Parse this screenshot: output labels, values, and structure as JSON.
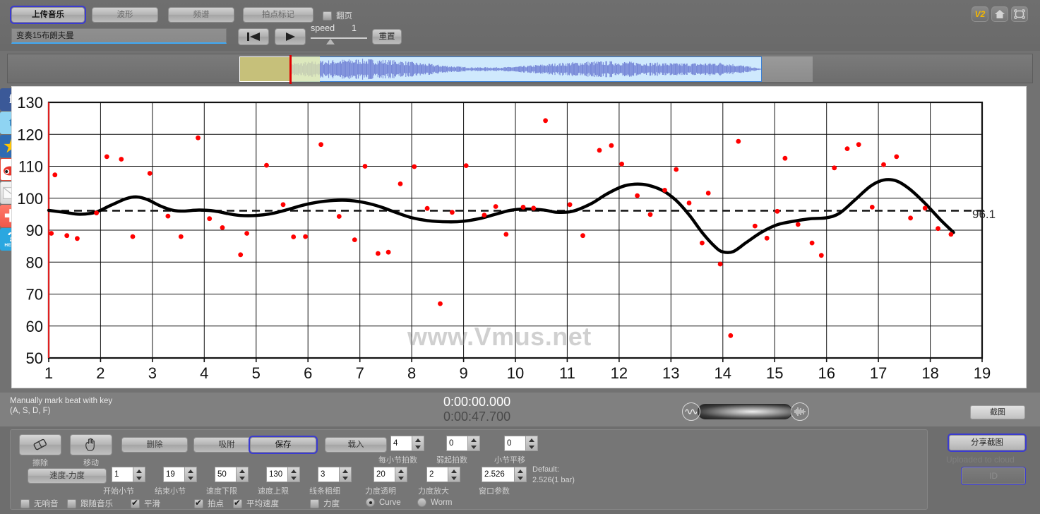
{
  "toolbar": {
    "buttons": [
      {
        "id": "upload",
        "label": "上传音乐",
        "selected": true
      },
      {
        "id": "wave",
        "label": "波形",
        "selected": false
      },
      {
        "id": "spectrum",
        "label": "频谱",
        "selected": false
      },
      {
        "id": "beatmark",
        "label": "拍点标记",
        "selected": false
      }
    ],
    "page_flip_label": "翻页",
    "page_flip_checked": false,
    "file_name": "变奏15布朗夫曼",
    "speed_label": "speed",
    "speed_value": "1",
    "reset_label": "重置",
    "corner_icons": [
      {
        "name": "v2-badge-icon",
        "label": "V2"
      },
      {
        "name": "home-icon",
        "label": ""
      },
      {
        "name": "fullscreen-icon",
        "label": ""
      }
    ]
  },
  "social": [
    {
      "name": "facebook-icon",
      "glyph": "f"
    },
    {
      "name": "twitter-icon",
      "glyph": "t"
    },
    {
      "name": "qzone-star-icon",
      "glyph": "★"
    },
    {
      "name": "weibo-icon",
      "glyph": "🅦"
    },
    {
      "name": "email-icon",
      "glyph": "✉"
    },
    {
      "name": "share-plus-icon",
      "glyph": "✚"
    },
    {
      "name": "help-icon",
      "glyph": "?",
      "sub": "HELP"
    }
  ],
  "chart_data": {
    "type": "scatter",
    "title": "",
    "xlabel": "",
    "ylabel": "",
    "watermark": "www.Vmus.net",
    "xlim": [
      1,
      19
    ],
    "ylim": [
      50,
      130
    ],
    "xticks": [
      1,
      2,
      3,
      4,
      5,
      6,
      7,
      8,
      9,
      10,
      11,
      12,
      13,
      14,
      15,
      16,
      17,
      18,
      19
    ],
    "yticks": [
      50,
      60,
      70,
      80,
      90,
      100,
      110,
      120,
      130
    ],
    "grid": true,
    "mean_line": {
      "value": 96.1,
      "label": "96.1",
      "style": "dashed"
    },
    "series": [
      {
        "name": "beat tempo points",
        "type": "scatter",
        "color": "#ff0000",
        "points": [
          [
            1.05,
            89.0
          ],
          [
            1.12,
            107.3
          ],
          [
            1.35,
            88.3
          ],
          [
            1.55,
            87.4
          ],
          [
            1.92,
            95.4
          ],
          [
            2.12,
            113.0
          ],
          [
            2.4,
            112.2
          ],
          [
            2.62,
            88.0
          ],
          [
            2.95,
            107.8
          ],
          [
            3.3,
            94.4
          ],
          [
            3.55,
            88.0
          ],
          [
            3.88,
            118.9
          ],
          [
            4.1,
            93.6
          ],
          [
            4.35,
            90.8
          ],
          [
            4.7,
            82.3
          ],
          [
            4.82,
            89.0
          ],
          [
            5.2,
            110.3
          ],
          [
            5.52,
            98.0
          ],
          [
            5.72,
            87.9
          ],
          [
            5.95,
            88.0
          ],
          [
            6.25,
            116.8
          ],
          [
            6.6,
            94.3
          ],
          [
            6.9,
            87.0
          ],
          [
            7.1,
            110.0
          ],
          [
            7.35,
            82.7
          ],
          [
            7.55,
            83.1
          ],
          [
            7.78,
            104.5
          ],
          [
            8.05,
            109.9
          ],
          [
            8.3,
            96.8
          ],
          [
            8.55,
            67.0
          ],
          [
            8.78,
            95.6
          ],
          [
            9.05,
            110.2
          ],
          [
            9.4,
            94.7
          ],
          [
            9.62,
            97.4
          ],
          [
            9.82,
            88.7
          ],
          [
            10.15,
            97.2
          ],
          [
            10.35,
            96.9
          ],
          [
            10.58,
            124.3
          ],
          [
            11.05,
            98.0
          ],
          [
            11.3,
            88.3
          ],
          [
            11.62,
            115.0
          ],
          [
            11.85,
            116.5
          ],
          [
            12.05,
            110.7
          ],
          [
            12.35,
            100.8
          ],
          [
            12.6,
            94.9
          ],
          [
            12.88,
            102.5
          ],
          [
            13.1,
            109.0
          ],
          [
            13.35,
            98.5
          ],
          [
            13.6,
            86.0
          ],
          [
            13.72,
            101.6
          ],
          [
            13.95,
            79.4
          ],
          [
            14.15,
            57.0
          ],
          [
            14.3,
            117.8
          ],
          [
            14.62,
            91.3
          ],
          [
            14.85,
            87.5
          ],
          [
            15.05,
            95.9
          ],
          [
            15.2,
            112.5
          ],
          [
            15.45,
            91.8
          ],
          [
            15.72,
            86.0
          ],
          [
            15.9,
            82.1
          ],
          [
            16.15,
            109.5
          ],
          [
            16.4,
            115.5
          ],
          [
            16.62,
            116.8
          ],
          [
            16.88,
            97.2
          ],
          [
            17.1,
            110.5
          ],
          [
            17.35,
            113.0
          ],
          [
            17.62,
            93.8
          ],
          [
            17.9,
            96.9
          ],
          [
            18.15,
            90.5
          ],
          [
            18.4,
            88.7
          ]
        ]
      },
      {
        "name": "smoothed tempo curve",
        "type": "line",
        "color": "#000000",
        "points": [
          [
            1.0,
            96.2
          ],
          [
            1.3,
            95.6
          ],
          [
            1.6,
            95.0
          ],
          [
            1.9,
            95.6
          ],
          [
            2.2,
            97.8
          ],
          [
            2.5,
            99.9
          ],
          [
            2.7,
            100.4
          ],
          [
            2.9,
            99.6
          ],
          [
            3.15,
            97.6
          ],
          [
            3.4,
            96.2
          ],
          [
            3.6,
            96.0
          ],
          [
            3.9,
            96.3
          ],
          [
            4.2,
            96.0
          ],
          [
            4.45,
            95.2
          ],
          [
            4.7,
            94.6
          ],
          [
            5.0,
            94.6
          ],
          [
            5.3,
            95.2
          ],
          [
            5.6,
            96.4
          ],
          [
            5.9,
            97.8
          ],
          [
            6.2,
            98.8
          ],
          [
            6.5,
            99.3
          ],
          [
            6.8,
            99.3
          ],
          [
            7.1,
            98.6
          ],
          [
            7.4,
            97.3
          ],
          [
            7.7,
            95.5
          ],
          [
            8.0,
            93.9
          ],
          [
            8.3,
            93.0
          ],
          [
            8.7,
            92.6
          ],
          [
            9.0,
            92.8
          ],
          [
            9.3,
            93.6
          ],
          [
            9.6,
            94.9
          ],
          [
            9.9,
            96.2
          ],
          [
            10.2,
            96.6
          ],
          [
            10.55,
            96.3
          ],
          [
            10.8,
            95.6
          ],
          [
            11.1,
            95.9
          ],
          [
            11.45,
            98.2
          ],
          [
            11.75,
            101.2
          ],
          [
            12.05,
            103.6
          ],
          [
            12.3,
            104.4
          ],
          [
            12.55,
            104.1
          ],
          [
            12.85,
            102.3
          ],
          [
            13.1,
            99.3
          ],
          [
            13.35,
            94.8
          ],
          [
            13.6,
            89.3
          ],
          [
            13.85,
            84.8
          ],
          [
            14.0,
            83.2
          ],
          [
            14.2,
            83.3
          ],
          [
            14.45,
            86.1
          ],
          [
            14.75,
            89.4
          ],
          [
            15.05,
            91.7
          ],
          [
            15.4,
            92.9
          ],
          [
            15.7,
            93.6
          ],
          [
            16.0,
            93.9
          ],
          [
            16.25,
            95.3
          ],
          [
            16.55,
            99.5
          ],
          [
            16.85,
            103.8
          ],
          [
            17.1,
            105.7
          ],
          [
            17.35,
            105.4
          ],
          [
            17.6,
            102.9
          ],
          [
            17.9,
            98.4
          ],
          [
            18.2,
            93.2
          ],
          [
            18.45,
            89.3
          ]
        ]
      }
    ]
  },
  "midbar": {
    "hint_line1": "Manually mark beat with key",
    "hint_line2": "(A, S, D, F)",
    "time_current": "0:00:00.000",
    "time_total": "0:00:47.700",
    "screenshot_label": "截图"
  },
  "bottom": {
    "tools": [
      {
        "name": "erase",
        "caption": "擦除",
        "icon": "eraser-icon"
      },
      {
        "name": "move",
        "caption": "移动",
        "icon": "hand-move-icon"
      }
    ],
    "actions": [
      {
        "id": "delete",
        "label": "删除",
        "selected": false
      },
      {
        "id": "snap",
        "label": "吸附",
        "selected": false
      },
      {
        "id": "save",
        "label": "保存",
        "selected": true
      },
      {
        "id": "load",
        "label": "载入",
        "selected": false
      }
    ],
    "velocity_button": "速度-力度",
    "spinners_row1": [
      {
        "id": "beats-per-bar",
        "value": "4",
        "caption": "每小节拍数"
      },
      {
        "id": "pickup-beats",
        "value": "0",
        "caption": "弱起拍数"
      },
      {
        "id": "bar-shift",
        "value": "0",
        "caption": "小节平移"
      }
    ],
    "spinners_row2": [
      {
        "id": "start-bar",
        "value": "1",
        "caption": "开始小节"
      },
      {
        "id": "end-bar",
        "value": "19",
        "caption": "结束小节"
      },
      {
        "id": "tempo-min",
        "value": "50",
        "caption": "速度下限"
      },
      {
        "id": "tempo-max",
        "value": "130",
        "caption": "速度上限"
      },
      {
        "id": "line-width",
        "value": "3",
        "caption": "线条粗细"
      },
      {
        "id": "velocity-alpha",
        "value": "20",
        "caption": "力度透明"
      },
      {
        "id": "velocity-scale",
        "value": "2",
        "caption": "力度放大"
      },
      {
        "id": "window-param",
        "value": "2.526",
        "caption": "窗口参数"
      }
    ],
    "default_note_line1": "Default:",
    "default_note_line2": "2.526(1 bar)",
    "checkboxes": [
      {
        "id": "no-resonance",
        "label": "无响音",
        "checked": false
      },
      {
        "id": "follow-music",
        "label": "跟随音乐",
        "checked": false
      },
      {
        "id": "smooth",
        "label": "平滑",
        "checked": true
      },
      {
        "id": "beats",
        "label": "拍点",
        "checked": true
      },
      {
        "id": "avg-tempo",
        "label": "平均速度",
        "checked": true
      },
      {
        "id": "velocity",
        "label": "力度",
        "checked": false
      }
    ],
    "radios": [
      {
        "id": "curve",
        "label": "Curve",
        "checked": true
      },
      {
        "id": "worm",
        "label": "Worm",
        "checked": false
      }
    ],
    "share_button": "分享截图",
    "share_status": "Uploaded to cloud",
    "share_id": "ID"
  }
}
